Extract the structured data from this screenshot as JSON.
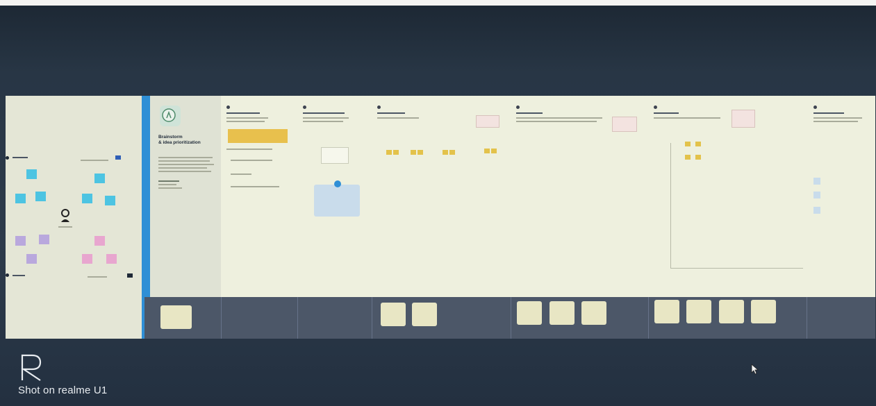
{
  "template": {
    "title_line1": "Brainstorm",
    "title_line2": "& idea prioritization"
  },
  "watermark": {
    "text": "Shot on realme U1"
  },
  "colors": {
    "accent": "#2f8fd6",
    "sticky_yellow": "#e3c24b",
    "sticky_cyan": "#4dc4e2",
    "sticky_lilac": "#b9a8dd",
    "sticky_pink": "#e8a6cf",
    "strip": "#4c5768"
  },
  "icons": [
    "avatar-icon",
    "lightbulb-icon",
    "mouse-pointer-icon",
    "realme-logo"
  ]
}
